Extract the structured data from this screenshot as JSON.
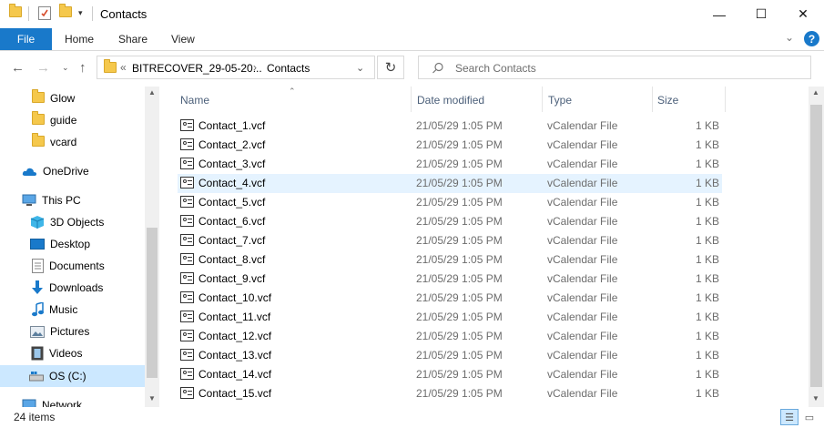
{
  "window": {
    "title": "Contacts",
    "minimize_glyph": "—",
    "maximize_glyph": "☐",
    "close_glyph": "✕"
  },
  "ribbon": {
    "tabs": [
      "File",
      "Home",
      "Share",
      "View"
    ],
    "help_glyph": "?"
  },
  "navigation": {
    "breadcrumb_prefix": "«",
    "breadcrumb": [
      "BITRECOVER_29-05-20...",
      "Contacts"
    ],
    "search_placeholder": "Search Contacts"
  },
  "nav_pane": {
    "items": [
      {
        "label": "Glow",
        "icon": "folder-icon"
      },
      {
        "label": "guide",
        "icon": "folder-icon"
      },
      {
        "label": "vcard",
        "icon": "folder-icon"
      },
      {
        "label": "OneDrive",
        "icon": "cloud-icon"
      },
      {
        "label": "This PC",
        "icon": "computer-icon"
      },
      {
        "label": "3D Objects",
        "icon": "cube-icon"
      },
      {
        "label": "Desktop",
        "icon": "desktop-icon"
      },
      {
        "label": "Documents",
        "icon": "documents-icon"
      },
      {
        "label": "Downloads",
        "icon": "download-icon"
      },
      {
        "label": "Music",
        "icon": "music-icon"
      },
      {
        "label": "Pictures",
        "icon": "pictures-icon"
      },
      {
        "label": "Videos",
        "icon": "videos-icon"
      },
      {
        "label": "OS (C:)",
        "icon": "drive-icon"
      },
      {
        "label": "Network",
        "icon": "network-icon"
      }
    ],
    "selected": "OS (C:)"
  },
  "file_list": {
    "columns": [
      "Name",
      "Date modified",
      "Type",
      "Size"
    ],
    "highlighted_row": "Contact_4.vcf",
    "rows": [
      {
        "name": "Contact_1.vcf",
        "date": "21/05/29 1:05 PM",
        "type": "vCalendar File",
        "size": "1 KB"
      },
      {
        "name": "Contact_2.vcf",
        "date": "21/05/29 1:05 PM",
        "type": "vCalendar File",
        "size": "1 KB"
      },
      {
        "name": "Contact_3.vcf",
        "date": "21/05/29 1:05 PM",
        "type": "vCalendar File",
        "size": "1 KB"
      },
      {
        "name": "Contact_4.vcf",
        "date": "21/05/29 1:05 PM",
        "type": "vCalendar File",
        "size": "1 KB"
      },
      {
        "name": "Contact_5.vcf",
        "date": "21/05/29 1:05 PM",
        "type": "vCalendar File",
        "size": "1 KB"
      },
      {
        "name": "Contact_6.vcf",
        "date": "21/05/29 1:05 PM",
        "type": "vCalendar File",
        "size": "1 KB"
      },
      {
        "name": "Contact_7.vcf",
        "date": "21/05/29 1:05 PM",
        "type": "vCalendar File",
        "size": "1 KB"
      },
      {
        "name": "Contact_8.vcf",
        "date": "21/05/29 1:05 PM",
        "type": "vCalendar File",
        "size": "1 KB"
      },
      {
        "name": "Contact_9.vcf",
        "date": "21/05/29 1:05 PM",
        "type": "vCalendar File",
        "size": "1 KB"
      },
      {
        "name": "Contact_10.vcf",
        "date": "21/05/29 1:05 PM",
        "type": "vCalendar File",
        "size": "1 KB"
      },
      {
        "name": "Contact_11.vcf",
        "date": "21/05/29 1:05 PM",
        "type": "vCalendar File",
        "size": "1 KB"
      },
      {
        "name": "Contact_12.vcf",
        "date": "21/05/29 1:05 PM",
        "type": "vCalendar File",
        "size": "1 KB"
      },
      {
        "name": "Contact_13.vcf",
        "date": "21/05/29 1:05 PM",
        "type": "vCalendar File",
        "size": "1 KB"
      },
      {
        "name": "Contact_14.vcf",
        "date": "21/05/29 1:05 PM",
        "type": "vCalendar File",
        "size": "1 KB"
      },
      {
        "name": "Contact_15.vcf",
        "date": "21/05/29 1:05 PM",
        "type": "vCalendar File",
        "size": "1 KB"
      }
    ]
  },
  "status": {
    "item_count": "24 items"
  },
  "colors": {
    "accent": "#1979ca",
    "selection": "#cce8ff",
    "hover_row": "#e5f3ff",
    "header_text": "#4c607a",
    "detail_text": "#6d6d6d"
  }
}
